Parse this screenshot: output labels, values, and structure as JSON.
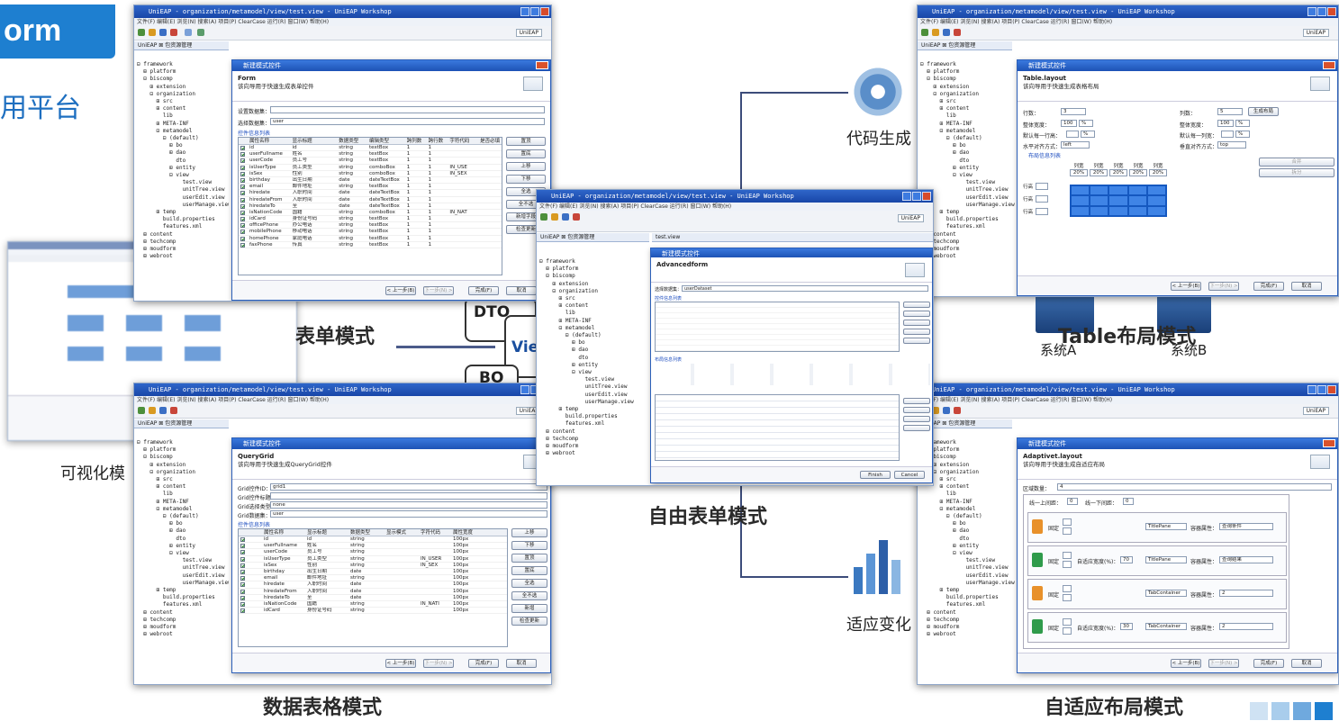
{
  "header": {
    "brand_fragment": "orm",
    "subtitle_fragment": "用平台"
  },
  "captions": {
    "form": "表单模式",
    "table": "Table布局模式",
    "grid": "数据表格模式",
    "free": "自由表单模式",
    "adaptive": "自适应布局模式",
    "codegen": "代码生成",
    "adapt": "适应变化",
    "visual": "可视化模",
    "system_a": "系统A",
    "system_b": "系统B"
  },
  "diagram": {
    "dto": "DTO",
    "view": "View",
    "bo": "BO"
  },
  "ide": {
    "title": "UniEAP - organization/metamodel/view/test.view - UniEAP Workshop",
    "menu": "文件(F)  编辑(E)  浏览(N)  搜索(A)  项目(P)  ClearCase  运行(R)  窗口(W)  帮助(H)",
    "perspective": "UniEAP",
    "view_tab": "UniEAP  ⊠  包资源管理",
    "editor_tab": "test.view",
    "tree": [
      "⊟ framework",
      "  ⊞ platform",
      "  ⊟ biscomp",
      "    ⊞ extension",
      "    ⊟ organization",
      "      ⊞ src",
      "      ⊞ content",
      "        lib",
      "      ⊞ META-INF",
      "      ⊟ metamodel",
      "        ⊟ (default)",
      "          ⊞ bo",
      "          ⊞ dao",
      "            dto",
      "          ⊞ entity",
      "          ⊟ view",
      "              test.view",
      "              unitTree.view",
      "              userEdit.view",
      "              userManage.view",
      "      ⊞ temp",
      "        build.properties",
      "        features.xml",
      "  ⊞ content",
      "  ⊞ techcomp",
      "  ⊞ moudform",
      "  ⊞ webroot"
    ]
  },
  "form_dialog": {
    "title": "新建模式控件",
    "heading": "Form",
    "desc": "该向导用于快速生成表单控件",
    "dataset_label": "设置数据集：",
    "select_label": "选择数据集：",
    "select_value": "user",
    "group": "控件信息列表",
    "columns": [
      "属性名称",
      "显示标题",
      "数据类型",
      "编辑类型",
      "跨列数",
      "跨行数",
      "字符代码",
      "是否必填"
    ],
    "rows": [
      [
        "id",
        "id",
        "string",
        "textBox",
        "1",
        "1",
        "",
        ""
      ],
      [
        "userFullname",
        "姓名",
        "string",
        "textBox",
        "1",
        "1",
        "",
        ""
      ],
      [
        "userCode",
        "员工号",
        "string",
        "textBox",
        "1",
        "1",
        "",
        ""
      ],
      [
        "isUserType",
        "员工类型",
        "string",
        "comboBox",
        "1",
        "1",
        "IN_USE",
        ""
      ],
      [
        "isSex",
        "性别",
        "string",
        "comboBox",
        "1",
        "1",
        "IN_SEX",
        ""
      ],
      [
        "birthday",
        "出生日期",
        "date",
        "dateTextBox",
        "1",
        "1",
        "",
        ""
      ],
      [
        "email",
        "邮件地址",
        "string",
        "textBox",
        "1",
        "1",
        "",
        ""
      ],
      [
        "hiredate",
        "入职时间",
        "date",
        "dateTextBox",
        "1",
        "1",
        "",
        ""
      ],
      [
        "hiredateFrom",
        "入职时间",
        "date",
        "dateTextBox",
        "1",
        "1",
        "",
        ""
      ],
      [
        "hiredateTo",
        "至",
        "date",
        "dateTextBox",
        "1",
        "1",
        "",
        ""
      ],
      [
        "isNationCode",
        "国籍",
        "string",
        "comboBox",
        "1",
        "1",
        "IN_NAT",
        ""
      ],
      [
        "idCard",
        "身份证号码",
        "string",
        "textBox",
        "1",
        "1",
        "",
        ""
      ],
      [
        "officePhone",
        "办公电话",
        "string",
        "textBox",
        "1",
        "1",
        "",
        ""
      ],
      [
        "mobilePhone",
        "移动电话",
        "string",
        "textBox",
        "1",
        "1",
        "",
        ""
      ],
      [
        "homePhone",
        "家庭电话",
        "string",
        "textBox",
        "1",
        "1",
        "",
        ""
      ],
      [
        "faxPhone",
        "传真",
        "string",
        "textBox",
        "1",
        "1",
        "",
        ""
      ]
    ],
    "side_buttons": [
      "置顶",
      "置底",
      "上移",
      "下移",
      "全选",
      "全不选",
      "新增字段",
      "检查更新"
    ],
    "footer": [
      "< 上一步(B)",
      "下一步(N) >",
      "完成(F)",
      "取消"
    ]
  },
  "table_dialog": {
    "title": "新建模式控件",
    "heading": "Table.layout",
    "desc": "该向导用于快速生成表格布局",
    "rows_label": "行数：",
    "rows_value": "3",
    "cols_label": "列数：",
    "cols_value": "5",
    "gen_button": "生成布局",
    "width_label": "整体宽度：",
    "width_value": "100",
    "width_unit": "%",
    "height_label": "整体宽度：",
    "height_value": "100",
    "height_unit": "%",
    "lineh_label": "默认每一行高：",
    "lineh_unit": "%",
    "colw_label": "默认每一列宽：",
    "colw_unit": "%",
    "halign_label": "水平对齐方式：",
    "halign_value": "left",
    "valign_label": "垂直对齐方式：",
    "valign_value": "top",
    "group": "布局信息列表",
    "col_headers": [
      "列宽",
      "列宽",
      "列宽",
      "列宽",
      "列宽"
    ],
    "col_values": [
      "20%",
      "20%",
      "20%",
      "20%",
      "20%"
    ],
    "row_labels": [
      "行高",
      "行高",
      "行高"
    ],
    "right_buttons": [
      "合并",
      "拆分"
    ],
    "footer": [
      "< 上一步(B)",
      "下一步(N) >",
      "完成(F)",
      "取消"
    ]
  },
  "grid_dialog": {
    "title": "新建模式控件",
    "heading": "QueryGrid",
    "desc": "该向导用于快速生成QueryGrid控件",
    "fields": [
      [
        "Grid控件ID：",
        "grid1"
      ],
      [
        "Grid控件标题：",
        ""
      ],
      [
        "Grid选择类型：",
        "none"
      ],
      [
        "Grid数据集：",
        "user"
      ]
    ],
    "group": "控件信息列表",
    "columns": [
      "属性名称",
      "显示标题",
      "数据类型",
      "显示模式",
      "字符代码",
      "属性宽度"
    ],
    "rows": [
      [
        "id",
        "id",
        "string",
        "",
        "",
        "100px"
      ],
      [
        "userFullname",
        "姓名",
        "string",
        "",
        "",
        "100px"
      ],
      [
        "userCode",
        "员工号",
        "string",
        "",
        "",
        "100px"
      ],
      [
        "isUserType",
        "员工类型",
        "string",
        "",
        "IN_USER",
        "100px"
      ],
      [
        "isSex",
        "性别",
        "string",
        "",
        "IN_SEX",
        "100px"
      ],
      [
        "birthday",
        "出生日期",
        "date",
        "",
        "",
        "100px"
      ],
      [
        "email",
        "邮件地址",
        "string",
        "",
        "",
        "100px"
      ],
      [
        "hiredate",
        "入职时间",
        "date",
        "",
        "",
        "100px"
      ],
      [
        "hiredateFrom",
        "入职时间",
        "date",
        "",
        "",
        "100px"
      ],
      [
        "hiredateTo",
        "至",
        "date",
        "",
        "",
        "100px"
      ],
      [
        "isNationCode",
        "国籍",
        "string",
        "",
        "IN_NATI",
        "100px"
      ],
      [
        "idCard",
        "身份证号码",
        "string",
        "",
        "",
        "100px"
      ]
    ],
    "side_buttons": [
      "上移",
      "下移",
      "置顶",
      "置底",
      "全选",
      "全不选",
      "新增",
      "检查更新"
    ],
    "footer": [
      "< 上一步(B)",
      "下一步(N) >",
      "完成(F)",
      "取消"
    ]
  },
  "adaptive_dialog": {
    "title": "新建模式控件",
    "heading": "Adaptivet.layout",
    "desc": "该向导用于快速生成自适应布局",
    "region_label": "区域数量：",
    "region_value": "4",
    "top_label": "线一上间距：",
    "top_value": "0",
    "bottom_label": "线一下间距：",
    "bottom_value": "0",
    "blocks": [
      {
        "fixed": "固定",
        "adaptive": "",
        "ratio": "",
        "container": "TitlePane",
        "attr_label": "容器属性：",
        "attr_value": "查询条件"
      },
      {
        "fixed": "固定",
        "adaptive": "自适应宽度(%)：",
        "ratio": "70",
        "container": "TitlePane",
        "attr_label": "容器属性：",
        "attr_value": "查询结果"
      },
      {
        "fixed": "固定",
        "adaptive": "",
        "ratio": "",
        "container": "TabContainer",
        "attr_label": "容器属性：",
        "attr_value": "2"
      },
      {
        "fixed": "固定",
        "adaptive": "自适应宽度(%)：",
        "ratio": "30",
        "container": "TabContainer",
        "attr_label": "容器属性：",
        "attr_value": "2"
      }
    ],
    "footer": [
      "< 上一步(B)",
      "下一步(N) >",
      "完成(F)",
      "取消"
    ]
  },
  "free_dialog": {
    "title": "新建模式控件",
    "heading": "Advancedform",
    "dataset_label": "选择数据集：",
    "dataset_value": "userDataset",
    "group1": "控件信息列表",
    "group2": "布局信息列表",
    "footer": [
      "Finish",
      "Cancel"
    ]
  },
  "colors": {
    "accent": "#1e7fd0",
    "title_blue": "#1846a8",
    "caption": "#2a2a2a"
  }
}
